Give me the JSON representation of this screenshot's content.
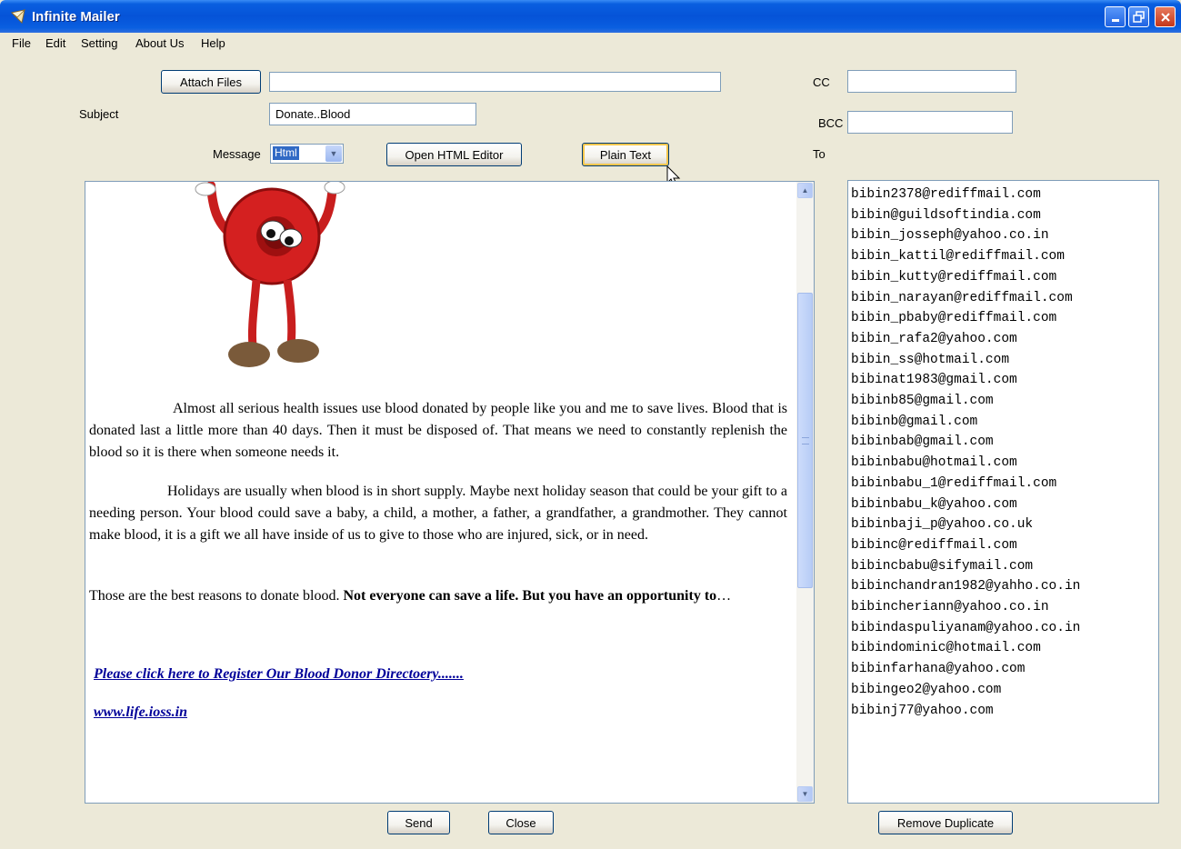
{
  "window": {
    "title": "Infinite Mailer"
  },
  "menu": [
    "File",
    "Edit",
    "Setting",
    "About Us",
    "Help"
  ],
  "compose": {
    "attach_label": "Attach Files",
    "attach_value": "",
    "subject_label": "Subject",
    "subject_value": "Donate..Blood",
    "message_label": "Message",
    "message_type": "Html",
    "open_html_label": "Open HTML Editor",
    "plain_text_label": "Plain Text",
    "cc_label": "CC",
    "cc_value": "",
    "bcc_label": "BCC",
    "bcc_value": "",
    "to_label": "To"
  },
  "body": {
    "para1": "Almost all serious health issues use blood donated by people like you and me to save lives. Blood that is donated last a little more than 40 days. Then it must be disposed of. That means we need to constantly replenish the blood so it is there when someone needs it.",
    "para2": "Holidays are usually when blood is in short supply. Maybe next holiday season that could be your gift to a needing person. Your blood could save a baby, a child, a mother, a father, a grandfather, a grandmother. They cannot make blood, it is a gift we all have inside of us to give to those who are injured, sick, or in need.",
    "para3_plain": "Those are the best reasons to donate blood. ",
    "para3_bold": "Not everyone can save a life. But you have an opportunity to",
    "para3_tail": "…",
    "link1": "Please click here to Register Our Blood Donor Directoery.......",
    "link2": "www.life.ioss.in"
  },
  "recipients": [
    "bibin2378@rediffmail.com",
    "bibin@guildsoftindia.com",
    "bibin_josseph@yahoo.co.in",
    "bibin_kattil@rediffmail.com",
    "bibin_kutty@rediffmail.com",
    "bibin_narayan@rediffmail.com",
    "bibin_pbaby@rediffmail.com",
    "bibin_rafa2@yahoo.com",
    "bibin_ss@hotmail.com",
    "bibinat1983@gmail.com",
    "bibinb85@gmail.com",
    "bibinb@gmail.com",
    "bibinbab@gmail.com",
    "bibinbabu@hotmail.com",
    "bibinbabu_1@rediffmail.com",
    "bibinbabu_k@yahoo.com",
    "bibinbaji_p@yahoo.co.uk",
    "bibinc@rediffmail.com",
    "bibincbabu@sifymail.com",
    "bibinchandran1982@yahho.co.in",
    "bibincheriann@yahoo.co.in",
    "bibindaspuliyanam@yahoo.co.in",
    "bibindominic@hotmail.com",
    "bibinfarhana@yahoo.com",
    "bibingeo2@yahoo.com",
    "bibinj77@yahoo.com"
  ],
  "footer": {
    "send_label": "Send",
    "close_label": "Close",
    "remove_dup_label": "Remove Duplicate"
  },
  "icons": {
    "app": "app-icon",
    "minimize": "minimize-icon",
    "maximize": "maximize-icon",
    "close": "close-icon"
  },
  "colors": {
    "titlebar": "#0553D8",
    "link": "#000099",
    "selection": "#316AC5"
  }
}
